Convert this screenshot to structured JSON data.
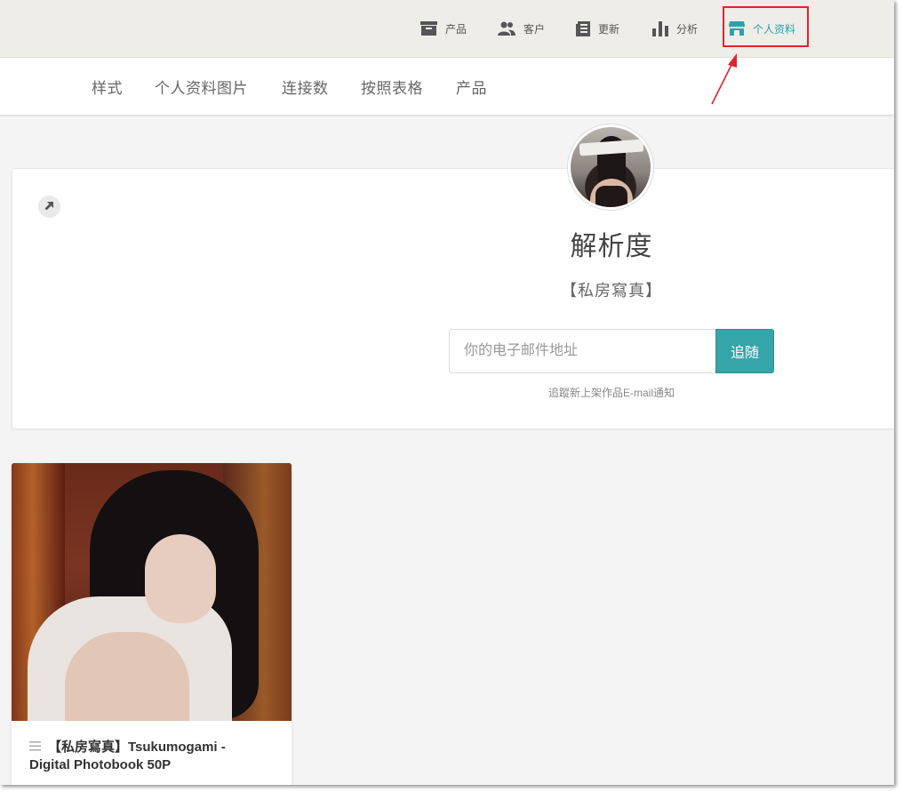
{
  "top_nav": {
    "items": [
      {
        "label": "产品",
        "icon": "archive-box-icon"
      },
      {
        "label": "客户",
        "icon": "users-icon"
      },
      {
        "label": "更新",
        "icon": "news-icon"
      },
      {
        "label": "分析",
        "icon": "bar-chart-icon"
      },
      {
        "label": "个人资料",
        "icon": "storefront-icon",
        "active": true
      }
    ]
  },
  "sub_nav": {
    "items": [
      "样式",
      "个人资料图片",
      "连接数",
      "按照表格",
      "产品"
    ]
  },
  "profile": {
    "name": "解析度",
    "subtitle": "【私房寫真】",
    "email_placeholder": "你的电子邮件地址",
    "follow_label": "追随",
    "follow_note": "追蹤新上架作品E-mail通知"
  },
  "products": [
    {
      "title_line1": "【私房寫真】Tsukumogami -",
      "title_line2": "Digital Photobook 50P"
    }
  ],
  "colors": {
    "accent": "#36a5a9",
    "active_nav": "#2aa3a8",
    "annotation": "#e0242f"
  }
}
